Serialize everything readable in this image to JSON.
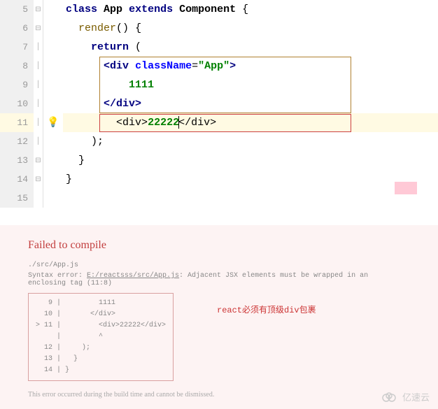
{
  "editor": {
    "lines": [
      "5",
      "6",
      "7",
      "8",
      "9",
      "10",
      "11",
      "12",
      "13",
      "14",
      "15"
    ],
    "active_line": "11",
    "code": {
      "l5": {
        "kw1": "class",
        "cls": "App",
        "kw2": "extends",
        "sup": "Component",
        "brace": "{"
      },
      "l6": {
        "fn": "render",
        "paren": "()",
        "brace": "{"
      },
      "l7": {
        "kw": "return",
        "paren": "("
      },
      "l8": {
        "open": "<",
        "tag": "div",
        "attr": "className",
        "eq": "=",
        "str": "\"App\"",
        "close": ">"
      },
      "l9": {
        "txt": "1111"
      },
      "l10": {
        "open": "</",
        "tag": "div",
        "close": ">"
      },
      "l11": {
        "open1": "<",
        "tag1": "div",
        "close1": ">",
        "txt": "22222",
        "open2": "</",
        "tag2": "div",
        "close2": ">"
      },
      "l12": {
        "close": ");"
      },
      "l13": {
        "brace": "}"
      },
      "l14": {
        "brace": "}"
      }
    }
  },
  "error": {
    "title": "Failed to compile",
    "file": "./src/App.js",
    "msg_prefix": "Syntax error: ",
    "msg_path": "E:/reactsss/src/App.js",
    "msg_suffix": ": Adjacent JSX elements must be wrapped in an enclosing tag (11:8)",
    "snippet": "   9 |         1111\n  10 |       </div>\n> 11 |         <div>22222</div>\n     |         ^\n  12 |     );\n  13 |   }\n  14 | }",
    "annotation": "react必须有顶级div包裹",
    "footer": "This error occurred during the build time and cannot be dismissed."
  },
  "watermark": {
    "text": "亿速云"
  }
}
